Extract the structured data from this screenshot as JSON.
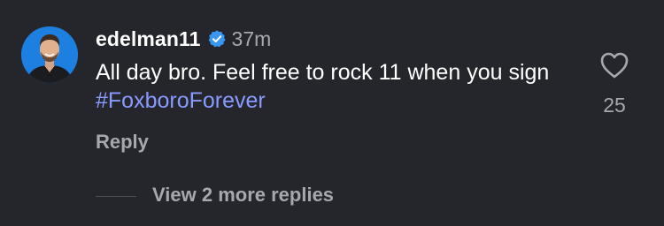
{
  "comment": {
    "username": "edelman11",
    "verified": true,
    "time": "37m",
    "text_main": "All day bro. Feel free to rock 11 when you sign ",
    "hashtag": "#FoxboroForever",
    "likes": "25",
    "reply_label": "Reply",
    "view_more_label": "View 2 more replies"
  },
  "icons": {
    "verified": "verified-badge-icon",
    "like": "heart-outline-icon"
  },
  "colors": {
    "background": "#24262b",
    "hashtag": "#8a9bff",
    "verified": "#3897f0",
    "muted": "#a6a8ad",
    "avatar_bg": "#1d7fe0"
  }
}
